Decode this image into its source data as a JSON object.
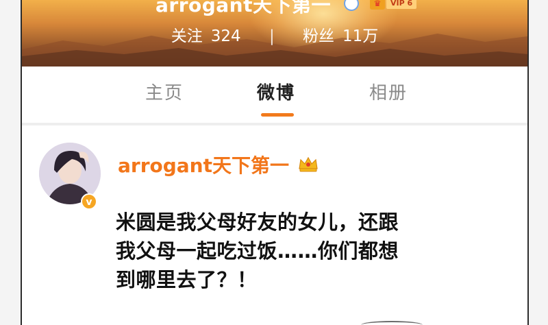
{
  "profile": {
    "name": "arrogant天下第一",
    "vip_label": "VIP 6",
    "following_label": "关注",
    "following_count": "324",
    "separator": "|",
    "followers_label": "粉丝",
    "followers_count": "11万"
  },
  "tabs": [
    {
      "label": "主页",
      "active": false
    },
    {
      "label": "微博",
      "active": true
    },
    {
      "label": "相册",
      "active": false
    }
  ],
  "post": {
    "author": "arrogant天下第一",
    "lines": [
      "米圆是我父母好友的女儿，还跟",
      "我父母一起吃过饭……你们都想",
      "到哪里去了？！"
    ]
  },
  "colors": {
    "accent": "#f27a1c",
    "username": "#f2761a",
    "verified": "#f6a623"
  },
  "icons": {
    "verify": "verified-blue-icon",
    "vip": "vip-crown-icon",
    "avatar_badge": "verified-v-icon"
  }
}
